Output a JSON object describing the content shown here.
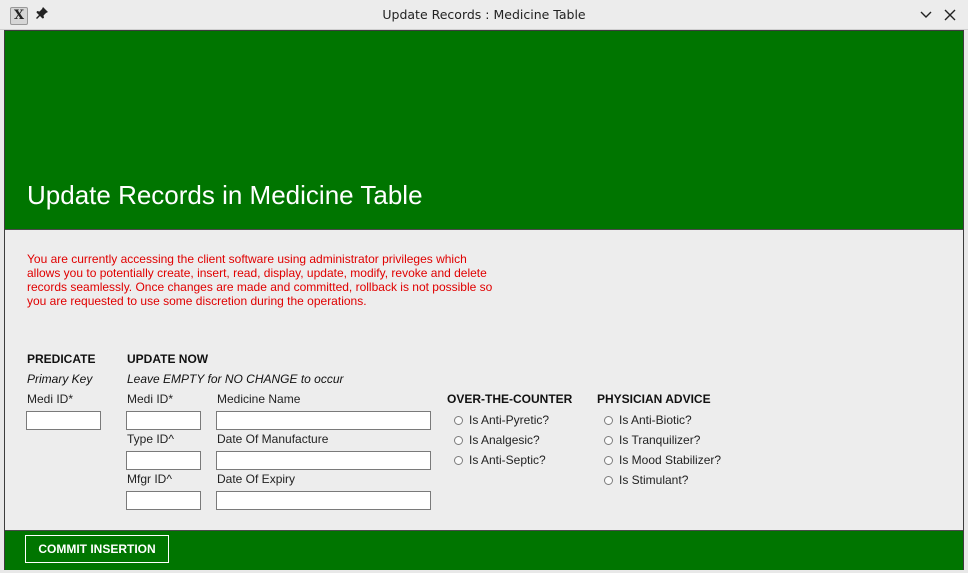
{
  "window": {
    "title": "Update Records : Medicine Table",
    "app_icon": "x-app-icon",
    "pin_icon": "pin-icon",
    "minimize_icon": "chevron-down-icon",
    "close_icon": "close-icon"
  },
  "header": {
    "title": "Update Records in Medicine Table",
    "background_color": "#007500"
  },
  "warning": {
    "text": "You are currently accessing the client software using administrator privileges which allows you to potentially create, insert, read, display, update, modify, revoke and delete records seamlessly. Once changes are made and committed, rollback is not possible so you are requested to use some discretion during the operations.",
    "color": "#e00000"
  },
  "predicate": {
    "heading": "PREDICATE",
    "subheading": "Primary Key",
    "medi_id_label": "Medi ID*",
    "medi_id_value": ""
  },
  "update_now": {
    "heading": "UPDATE NOW",
    "subheading": "Leave EMPTY for NO CHANGE to occur",
    "medi_id_label": "Medi ID*",
    "medi_id_value": "",
    "medicine_name_label": "Medicine Name",
    "medicine_name_value": "",
    "type_id_label": "Type ID^",
    "type_id_value": "",
    "date_of_manufacture_label": "Date Of Manufacture",
    "date_of_manufacture_value": "",
    "mfgr_id_label": "Mfgr ID^",
    "mfgr_id_value": "",
    "date_of_expiry_label": "Date Of Expiry",
    "date_of_expiry_value": ""
  },
  "otc": {
    "heading": "OVER-THE-COUNTER",
    "options": [
      "Is Anti-Pyretic?",
      "Is Analgesic?",
      "Is Anti-Septic?"
    ]
  },
  "physician": {
    "heading": "PHYSICIAN ADVICE",
    "options": [
      "Is Anti-Biotic?",
      "Is Tranquilizer?",
      "Is Mood Stabilizer?",
      "Is Stimulant?"
    ]
  },
  "footer": {
    "commit_label": "COMMIT INSERTION",
    "background_color": "#007500"
  }
}
